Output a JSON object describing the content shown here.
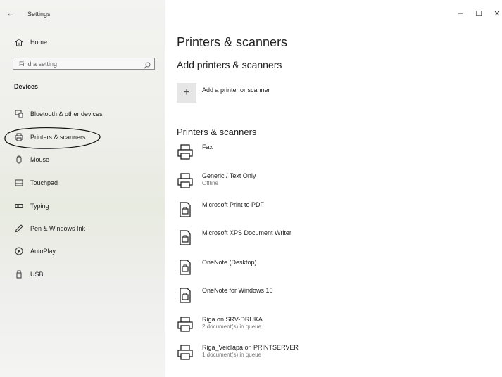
{
  "window": {
    "title": "Settings",
    "back_glyph": "←",
    "minimize_glyph": "–",
    "maximize_glyph": "☐",
    "close_glyph": "✕"
  },
  "sidebar": {
    "home_label": "Home",
    "search_placeholder": "Find a setting",
    "section_title": "Devices",
    "items": [
      {
        "label": "Bluetooth & other devices",
        "icon": "bluetooth-devices-icon"
      },
      {
        "label": "Printers & scanners",
        "icon": "printer-icon"
      },
      {
        "label": "Mouse",
        "icon": "mouse-icon"
      },
      {
        "label": "Touchpad",
        "icon": "touchpad-icon"
      },
      {
        "label": "Typing",
        "icon": "keyboard-icon"
      },
      {
        "label": "Pen & Windows Ink",
        "icon": "pen-icon"
      },
      {
        "label": "AutoPlay",
        "icon": "autoplay-icon"
      },
      {
        "label": "USB",
        "icon": "usb-icon"
      }
    ]
  },
  "main": {
    "title": "Printers & scanners",
    "add_section_title": "Add printers & scanners",
    "add_label": "Add a printer or scanner",
    "add_glyph": "+",
    "list_title": "Printers & scanners",
    "printers": [
      {
        "name": "Fax",
        "status": "",
        "icon": "printer-icon"
      },
      {
        "name": "Generic / Text Only",
        "status": "Offline",
        "icon": "printer-icon"
      },
      {
        "name": "Microsoft Print to PDF",
        "status": "",
        "icon": "document-printer-icon"
      },
      {
        "name": "Microsoft XPS Document Writer",
        "status": "",
        "icon": "document-printer-icon"
      },
      {
        "name": "OneNote (Desktop)",
        "status": "",
        "icon": "document-printer-icon"
      },
      {
        "name": "OneNote for Windows 10",
        "status": "",
        "icon": "document-printer-icon"
      },
      {
        "name": "Riga on SRV-DRUKA",
        "status": "2 document(s) in queue",
        "icon": "printer-icon"
      },
      {
        "name": "Riga_Veidlapa on PRINTSERVER",
        "status": "1 document(s) in queue",
        "icon": "printer-icon"
      }
    ]
  }
}
